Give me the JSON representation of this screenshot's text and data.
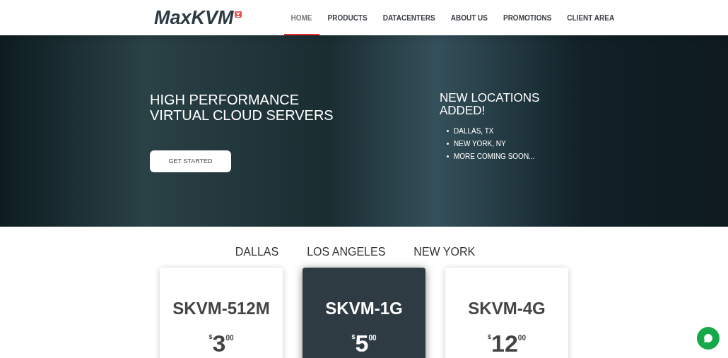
{
  "header": {
    "logo": "MaxKVM",
    "nav": [
      {
        "label": "HOME",
        "selected": true
      },
      {
        "label": "PRODUCTS",
        "selected": false
      },
      {
        "label": "DATACENTERS",
        "selected": false
      },
      {
        "label": "ABOUT US",
        "selected": false
      },
      {
        "label": "PROMOTIONS",
        "selected": false
      },
      {
        "label": "CLIENT AREA",
        "selected": false
      }
    ]
  },
  "hero": {
    "title_lines": [
      "HIGH PERFORMANCE",
      "VIRTUAL CLOUD SERVERS"
    ],
    "button": "GET STARTED",
    "side_title_lines": [
      "NEW LOCATIONS",
      "ADDED!"
    ],
    "side_items": [
      "DALLAS, TX",
      "NEW YORK, NY",
      "MORE COMING SOON..."
    ]
  },
  "locations": [
    "DALLAS",
    "LOS ANGELES",
    "NEW YORK"
  ],
  "plans": [
    {
      "name": "SKVM-512M",
      "currency": "$",
      "price": "3",
      "cents": "00",
      "featured": false
    },
    {
      "name": "SKVM-1G",
      "currency": "$",
      "price": "5",
      "cents": "00",
      "featured": true
    },
    {
      "name": "SKVM-4G",
      "currency": "$",
      "price": "12",
      "cents": "00",
      "featured": false
    }
  ]
}
